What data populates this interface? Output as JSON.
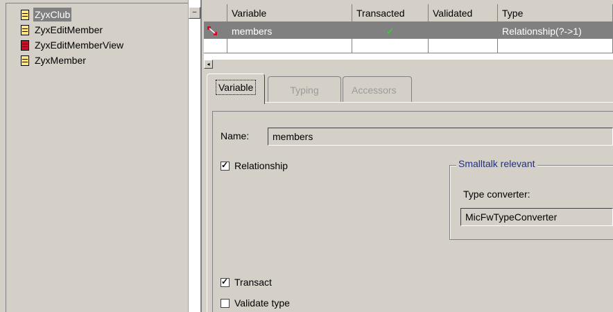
{
  "class_list": {
    "items": [
      {
        "label": "ZyxClub",
        "icon": "class-icon",
        "icon_color": "#ffe680",
        "selected": true
      },
      {
        "label": "ZyxEditMember",
        "icon": "class-icon",
        "icon_color": "#ffe680",
        "selected": false
      },
      {
        "label": "ZyxEditMemberView",
        "icon": "class-icon",
        "icon_color": "#c8102e",
        "selected": false
      },
      {
        "label": "ZyxMember",
        "icon": "class-icon",
        "icon_color": "#ffe680",
        "selected": false
      }
    ]
  },
  "grid": {
    "columns": [
      "Variable",
      "Transacted",
      "Validated",
      "Type"
    ],
    "rows": [
      {
        "variable": "members",
        "transacted": "✓",
        "validated": "",
        "type": "Relationship(?->1)",
        "icon": "relationship-icon"
      }
    ]
  },
  "tabs": [
    {
      "label": "Variable",
      "active": true,
      "enabled": true
    },
    {
      "label": "Typing",
      "active": false,
      "enabled": false
    },
    {
      "label": "Accessors",
      "active": false,
      "enabled": false
    }
  ],
  "form": {
    "name_label": "Name:",
    "name_value": "members",
    "relationship_label": "Relationship",
    "relationship_checked": true,
    "group_title": "Smalltalk relevant",
    "type_converter_label": "Type converter:",
    "type_converter_value": "MicFwTypeConverter",
    "transact_label": "Transact",
    "transact_checked": true,
    "validate_label": "Validate type",
    "validate_checked": false
  },
  "colors": {
    "selection_bg": "#808080",
    "group_title": "#203080",
    "check_green": "#2a9d2a",
    "relationship_icon": "#c8102e"
  }
}
